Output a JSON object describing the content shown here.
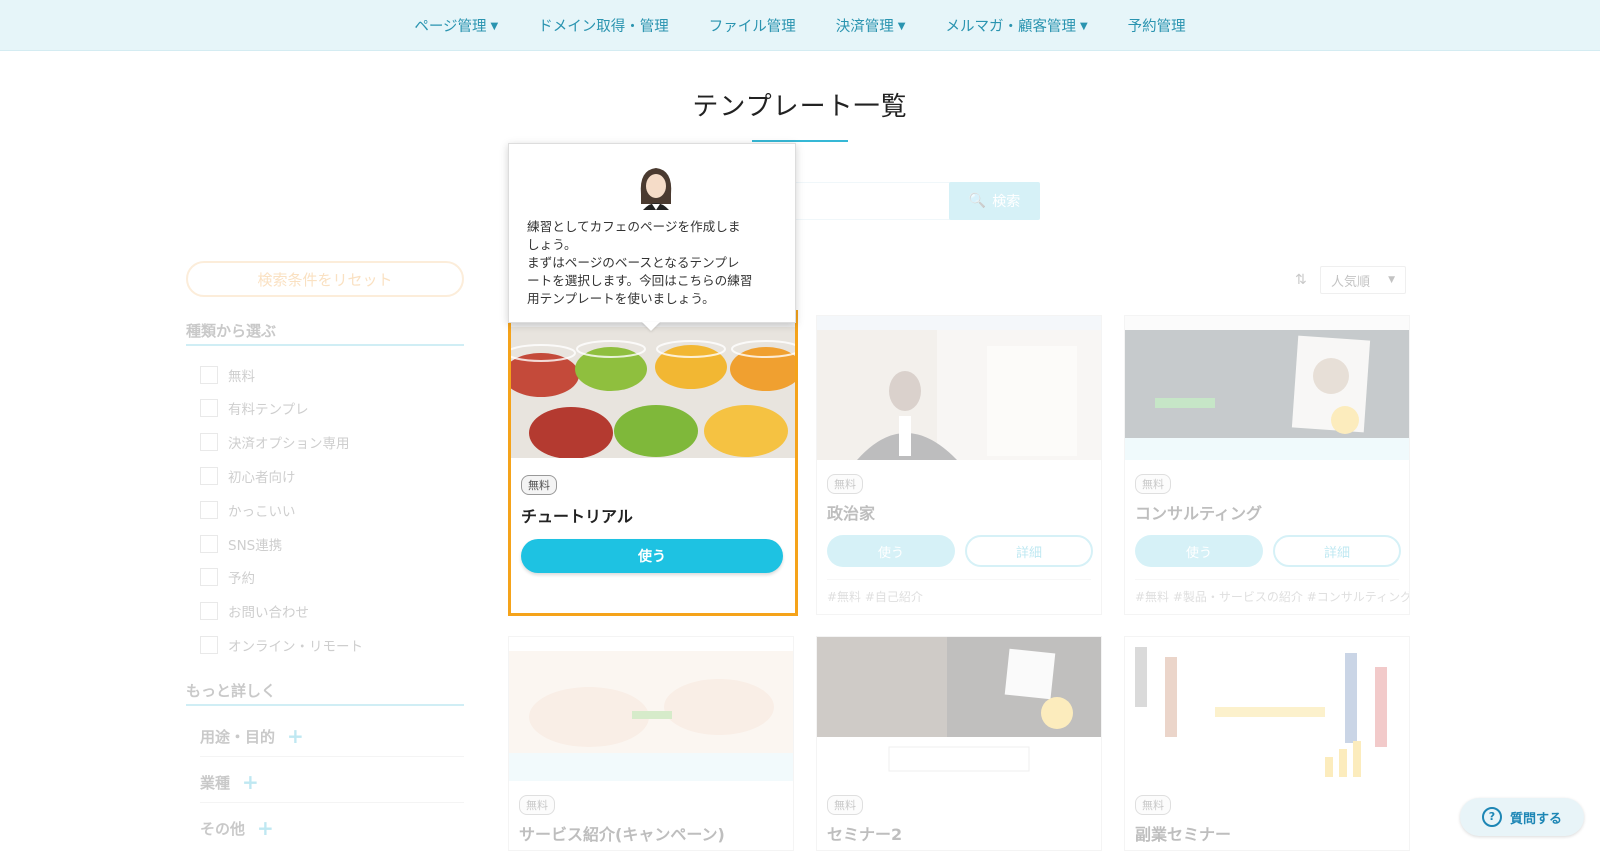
{
  "nav": {
    "items": [
      {
        "label": "ページ管理",
        "has_dropdown": true
      },
      {
        "label": "ドメイン取得・管理",
        "has_dropdown": false
      },
      {
        "label": "ファイル管理",
        "has_dropdown": false
      },
      {
        "label": "決済管理",
        "has_dropdown": true
      },
      {
        "label": "メルマガ・顧客管理",
        "has_dropdown": true
      },
      {
        "label": "予約管理",
        "has_dropdown": false
      }
    ]
  },
  "page": {
    "title": "テンプレート一覧"
  },
  "search": {
    "button_label": "検索",
    "value": ""
  },
  "sidebar": {
    "reset_label": "検索条件をリセット",
    "type_heading": "種類から選ぶ",
    "type_options": [
      "無料",
      "有料テンプレ",
      "決済オプション専用",
      "初心者向け",
      "かっこいい",
      "SNS連携",
      "予約",
      "お問い合わせ",
      "オンライン・リモート"
    ],
    "more_heading": "もっと詳しく",
    "more_items": [
      "用途・目的",
      "業種",
      "その他"
    ]
  },
  "sort": {
    "selected": "人気順"
  },
  "tooltip": {
    "text": "練習としてカフェのページを作成しま\nしょう。\nまずはページのベースとなるテンプレ\nートを選択します。今回はこちらの練習\n用テンプレートを使いましょう。"
  },
  "highlight_card": {
    "badge": "無料",
    "name": "チュートリアル",
    "use_label": "使う"
  },
  "cards": [
    {
      "badge": "無料",
      "name": "政治家",
      "use_label": "使う",
      "detail_label": "詳細",
      "tags": "#無料 #自己紹介"
    },
    {
      "badge": "無料",
      "name": "コンサルティング",
      "use_label": "使う",
      "detail_label": "詳細",
      "tags": "#無料 #製品・サービスの紹介 #コンサルティング"
    },
    {
      "badge": "無料",
      "name": "サービス紹介(キャンペーン)"
    },
    {
      "badge": "無料",
      "name": "セミナー2"
    },
    {
      "badge": "無料",
      "name": "副業セミナー"
    }
  ],
  "help": {
    "label": "質問する"
  },
  "colors": {
    "accent": "#1ec2e2",
    "highlight_border": "#f5a31a",
    "nav_bg": "#e6f5f9"
  }
}
